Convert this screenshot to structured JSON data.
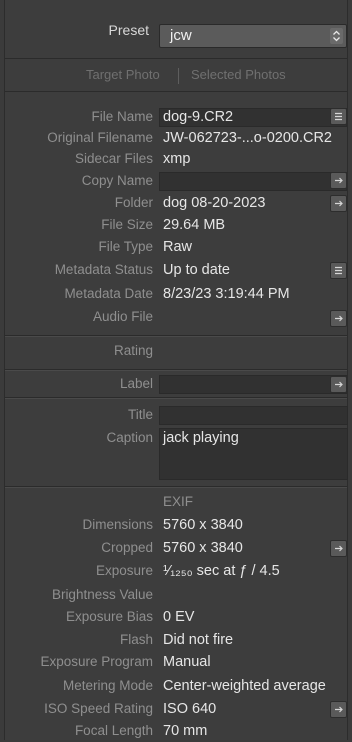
{
  "preset": {
    "label": "Preset",
    "value": "jcw"
  },
  "tabs": {
    "target": "Target Photo",
    "selected": "Selected Photos"
  },
  "file": {
    "file_name_label": "File Name",
    "file_name": "dog-9.CR2",
    "original_filename_label": "Original Filename",
    "original_filename": "JW-062723-...o-0200.CR2",
    "sidecar_label": "Sidecar Files",
    "sidecar": "xmp",
    "copy_name_label": "Copy Name",
    "copy_name": "",
    "folder_label": "Folder",
    "folder": "dog 08-20-2023",
    "file_size_label": "File Size",
    "file_size": "29.64 MB",
    "file_type_label": "File Type",
    "file_type": "Raw",
    "metadata_status_label": "Metadata Status",
    "metadata_status": "Up to date",
    "metadata_date_label": "Metadata Date",
    "metadata_date": "8/23/23 3:19:44 PM",
    "audio_file_label": "Audio File",
    "audio_file": ""
  },
  "rating": {
    "label": "Rating"
  },
  "label_section": {
    "label": "Label",
    "value": ""
  },
  "content": {
    "title_label": "Title",
    "title": "",
    "caption_label": "Caption",
    "caption": "jack playing"
  },
  "exif": {
    "heading": "EXIF",
    "dimensions_label": "Dimensions",
    "dimensions": "5760 x 3840",
    "cropped_label": "Cropped",
    "cropped": "5760 x 3840",
    "exposure_label": "Exposure",
    "exposure_frac": "¹⁄₁₂₅₀",
    "exposure_rest": " sec at ƒ / 4.5",
    "brightness_label": "Brightness Value",
    "brightness": "",
    "exposure_bias_label": "Exposure Bias",
    "exposure_bias": "0 EV",
    "flash_label": "Flash",
    "flash": "Did not fire",
    "exposure_program_label": "Exposure Program",
    "exposure_program": "Manual",
    "metering_label": "Metering Mode",
    "metering": "Center-weighted average",
    "iso_label": "ISO Speed Rating",
    "iso": "ISO 640",
    "focal_label": "Focal Length",
    "focal": "70 mm"
  }
}
